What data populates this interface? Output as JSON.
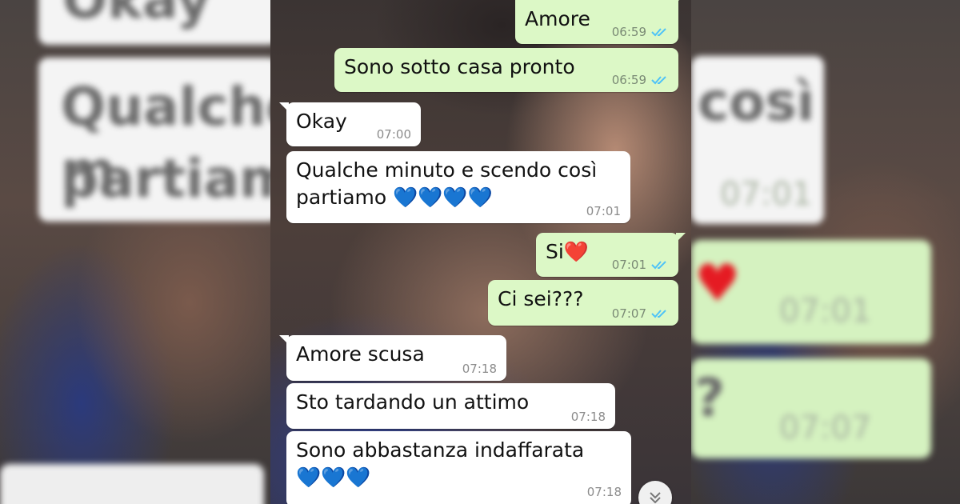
{
  "colors": {
    "incoming_bubble": "#ffffff",
    "outgoing_bubble": "#dcf8c6",
    "read_tick": "#4fc3f7",
    "timestamp": "#8c8c8c"
  },
  "background": {
    "left_ghost": {
      "line1": "Okay",
      "line2": "Qualche m",
      "line3": "partiamo"
    },
    "right_ghost": {
      "line1": "così",
      "time1": "07:01",
      "time2": "07:01",
      "line2": "?",
      "time3": "07:07"
    }
  },
  "messages": [
    {
      "direction": "out",
      "text": "Amore",
      "time": "06:59",
      "status_icon": "double-check-read-icon"
    },
    {
      "direction": "out",
      "text": "Sono sotto casa pronto",
      "time": "06:59",
      "status_icon": "double-check-read-icon"
    },
    {
      "direction": "in",
      "text": "Okay",
      "time": "07:00"
    },
    {
      "direction": "in",
      "text": "Qualche minuto e scendo così\npartiamo 💙💙💙💙",
      "time": "07:01"
    },
    {
      "direction": "out",
      "text": "Si❤️",
      "time": "07:01",
      "status_icon": "double-check-read-icon"
    },
    {
      "direction": "out",
      "text": "Ci sei???",
      "time": "07:07",
      "status_icon": "double-check-read-icon"
    },
    {
      "direction": "in",
      "text": "Amore scusa",
      "time": "07:18"
    },
    {
      "direction": "in",
      "text": "Sto tardando un attimo",
      "time": "07:18"
    },
    {
      "direction": "in",
      "text": "Sono abbastanza indaffarata\n💙💙💙",
      "time": "07:18"
    }
  ],
  "scroll_button_icon": "chevron-down-icon"
}
